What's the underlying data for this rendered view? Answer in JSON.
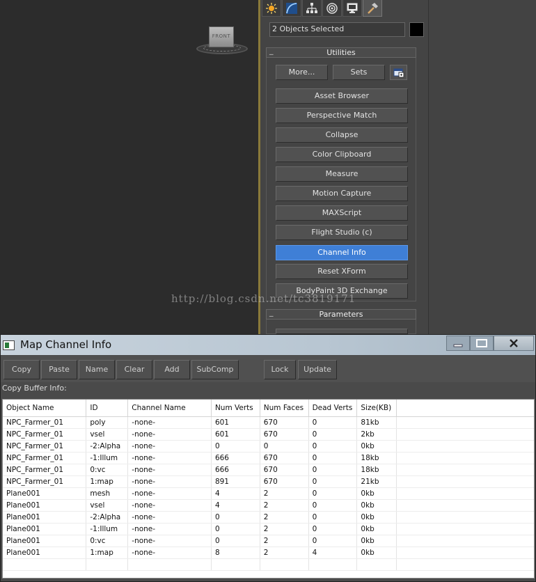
{
  "viewport": {
    "viewcube_label": "FRONT"
  },
  "command_panel": {
    "tabs": [
      {
        "name": "create-tab",
        "icon": "sun-icon"
      },
      {
        "name": "modify-tab",
        "icon": "curve-icon"
      },
      {
        "name": "hierarchy-tab",
        "icon": "hierarchy-icon"
      },
      {
        "name": "motion-tab",
        "icon": "motion-icon"
      },
      {
        "name": "display-tab",
        "icon": "monitor-icon"
      },
      {
        "name": "utilities-tab",
        "icon": "hammer-icon"
      }
    ],
    "selection_text": "2 Objects Selected",
    "utilities": {
      "header": "Utilities",
      "collapse": "_",
      "more": "More...",
      "sets": "Sets",
      "buttons": [
        "Asset Browser",
        "Perspective Match",
        "Collapse",
        "Color Clipboard",
        "Measure",
        "Motion Capture",
        "MAXScript",
        "Flight Studio (c)",
        "Channel Info",
        "Reset XForm",
        "BodyPaint 3D Exchange"
      ],
      "active_button": "Channel Info"
    },
    "parameters": {
      "header": "Parameters",
      "collapse": "_",
      "hidden_button": "Channel Info"
    }
  },
  "watermark": "http://blog.csdn.net/tc3819171",
  "dialog": {
    "title": "Map Channel Info",
    "toolbar": {
      "copy": "Copy",
      "paste": "Paste",
      "name": "Name",
      "clear": "Clear",
      "add": "Add",
      "subcomp": "SubComp",
      "lock": "Lock",
      "update": "Update"
    },
    "buffer_info": "Copy Buffer Info:",
    "columns": [
      "Object Name",
      "ID",
      "Channel Name",
      "Num Verts",
      "Num Faces",
      "Dead Verts",
      "Size(KB)"
    ],
    "rows": [
      [
        "NPC_Farmer_01",
        "poly",
        "-none-",
        "601",
        "670",
        "0",
        "81kb"
      ],
      [
        "NPC_Farmer_01",
        "vsel",
        "-none-",
        "601",
        "670",
        "0",
        "2kb"
      ],
      [
        "NPC_Farmer_01",
        "-2:Alpha",
        "-none-",
        "0",
        "0",
        "0",
        "0kb"
      ],
      [
        "NPC_Farmer_01",
        "-1:Illum",
        "-none-",
        "666",
        "670",
        "0",
        "18kb"
      ],
      [
        "NPC_Farmer_01",
        "0:vc",
        "-none-",
        "666",
        "670",
        "0",
        "18kb"
      ],
      [
        "NPC_Farmer_01",
        "1:map",
        "-none-",
        "891",
        "670",
        "0",
        "21kb"
      ],
      [
        "Plane001",
        "mesh",
        "-none-",
        "4",
        "2",
        "0",
        "0kb"
      ],
      [
        "Plane001",
        "vsel",
        "-none-",
        "4",
        "2",
        "0",
        "0kb"
      ],
      [
        "Plane001",
        "-2:Alpha",
        "-none-",
        "0",
        "2",
        "0",
        "0kb"
      ],
      [
        "Plane001",
        "-1:Illum",
        "-none-",
        "0",
        "2",
        "0",
        "0kb"
      ],
      [
        "Plane001",
        "0:vc",
        "-none-",
        "0",
        "2",
        "0",
        "0kb"
      ],
      [
        "Plane001",
        "1:map",
        "-none-",
        "8",
        "2",
        "4",
        "0kb"
      ]
    ]
  }
}
